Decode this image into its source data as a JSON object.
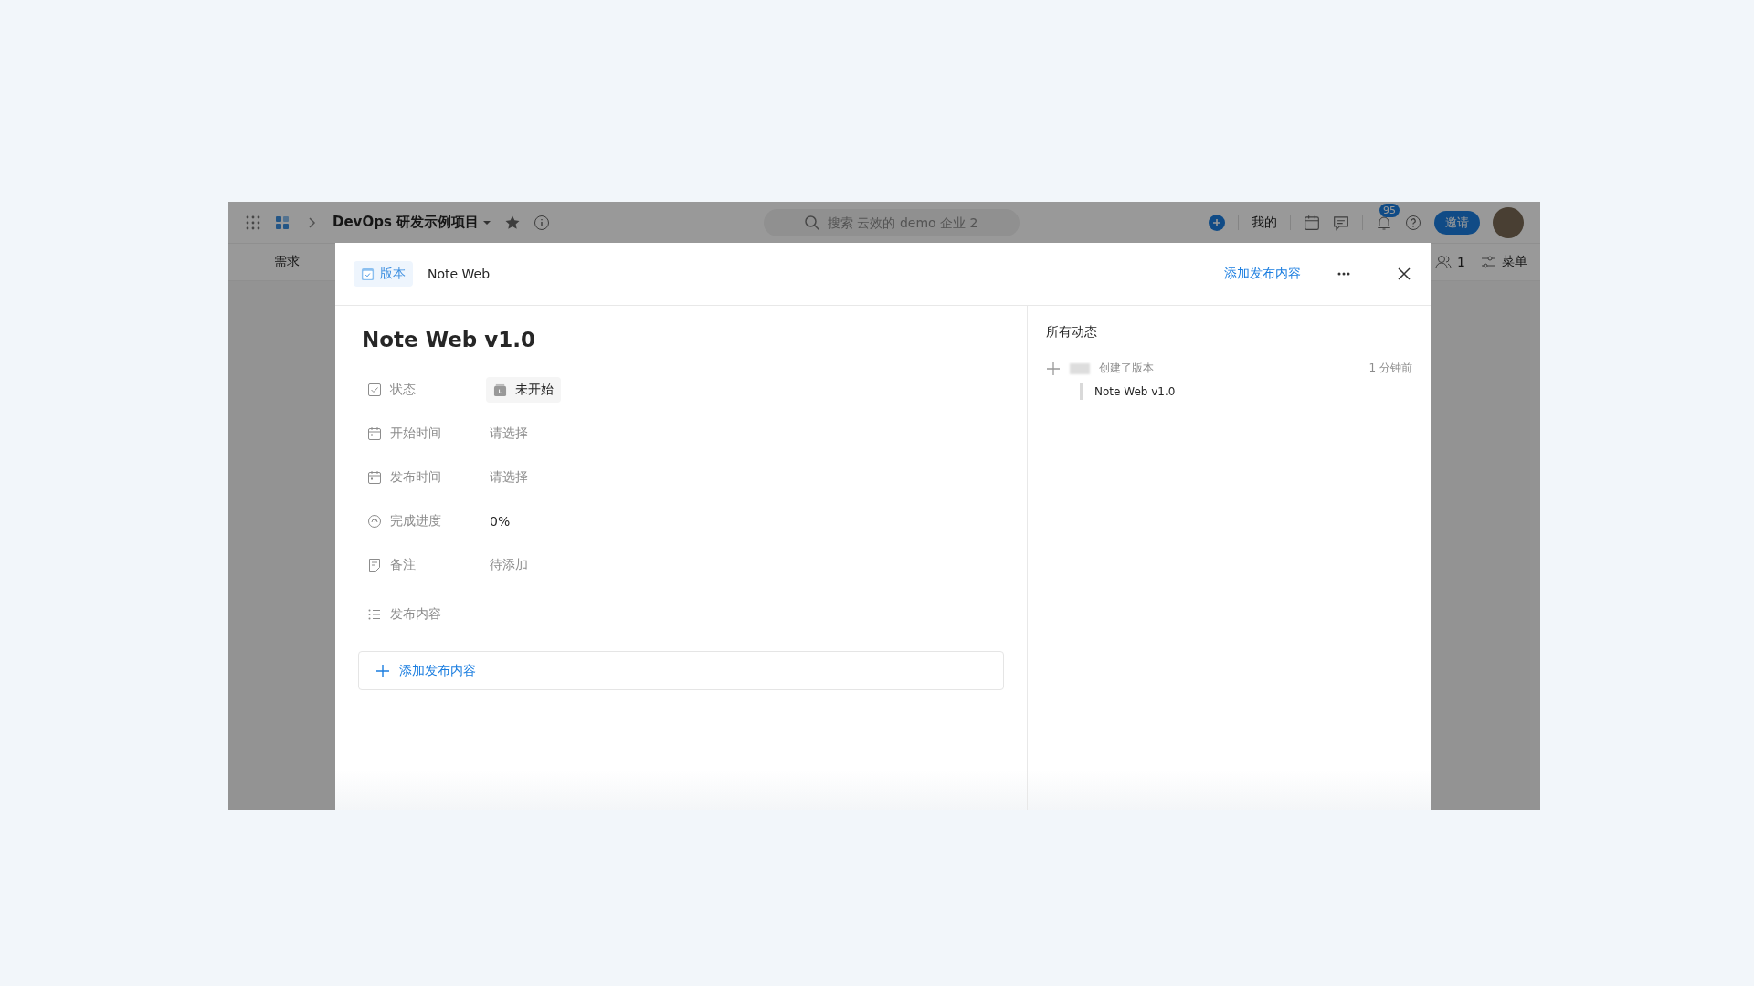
{
  "app_bar": {
    "project": "DevOps 研发示例项目",
    "search": {
      "placeholder": "搜索 云效的 demo 企业 2"
    },
    "mine": "我的",
    "notification_count": "95",
    "invite": "邀请"
  },
  "nav_tabs": [
    {
      "label": "需求"
    }
  ],
  "members_count": "1",
  "menu": "菜单",
  "dialog": {
    "type_tag": "版本",
    "breadcrumb": "Note Web",
    "add_link": "添加发布内容",
    "title": "Note Web v1.0",
    "fields": [
      {
        "kind": "status",
        "label": "状态",
        "value": "未开始"
      },
      {
        "kind": "date",
        "label": "开始时间",
        "placeholder": "请选择"
      },
      {
        "kind": "date",
        "label": "发布时间",
        "placeholder": "请选择"
      },
      {
        "kind": "progress",
        "label": "完成进度",
        "value": "0%"
      },
      {
        "kind": "note",
        "label": "备注",
        "placeholder": "待添加"
      },
      {
        "kind": "list",
        "label": "发布内容"
      }
    ],
    "add_button": "添加发布内容",
    "activity": {
      "title": "所有动态",
      "items": [
        {
          "action": "创建了版本",
          "time": "1 分钟前",
          "detail": "Note Web v1.0"
        }
      ]
    }
  }
}
